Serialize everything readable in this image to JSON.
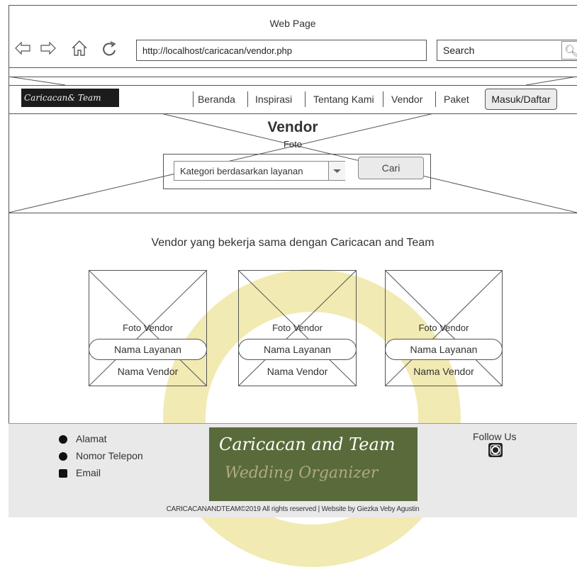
{
  "browser": {
    "title": "Web Page",
    "url": "http://localhost/caricacan/vendor.php",
    "search_placeholder": "Search"
  },
  "navbar": {
    "logo_text": "Caricacan& Team",
    "items": [
      {
        "label": "Beranda"
      },
      {
        "label": "Inspirasi"
      },
      {
        "label": "Tentang Kami"
      },
      {
        "label": "Vendor"
      },
      {
        "label": "Paket"
      }
    ],
    "login_label": "Masuk/Daftar"
  },
  "hero": {
    "title": "Vendor",
    "image_label": "Foto",
    "category_select": "Kategori berdasarkan layanan",
    "search_button": "Cari"
  },
  "vendors": {
    "heading": "Vendor yang bekerja sama dengan Caricacan and Team",
    "cards": [
      {
        "foto": "Foto Vendor",
        "layanan": "Nama Layanan",
        "vendor": "Nama Vendor"
      },
      {
        "foto": "Foto Vendor",
        "layanan": "Nama Layanan",
        "vendor": "Nama Vendor"
      },
      {
        "foto": "Foto Vendor",
        "layanan": "Nama Layanan",
        "vendor": "Nama Vendor"
      }
    ]
  },
  "footer": {
    "contact": [
      {
        "label": "Alamat",
        "icon": "location-icon"
      },
      {
        "label": "Nomor Telepon",
        "icon": "phone-icon"
      },
      {
        "label": "Email",
        "icon": "email-icon"
      }
    ],
    "logo_line1": "Caricacan and Team",
    "logo_line2": "Wedding Organizer",
    "follow_label": "Follow Us",
    "social_icon": "instagram-icon",
    "copyright": "CARICACANANDTEAM©2019 All rights reserved | Website by Giezka Veby Agustin"
  }
}
